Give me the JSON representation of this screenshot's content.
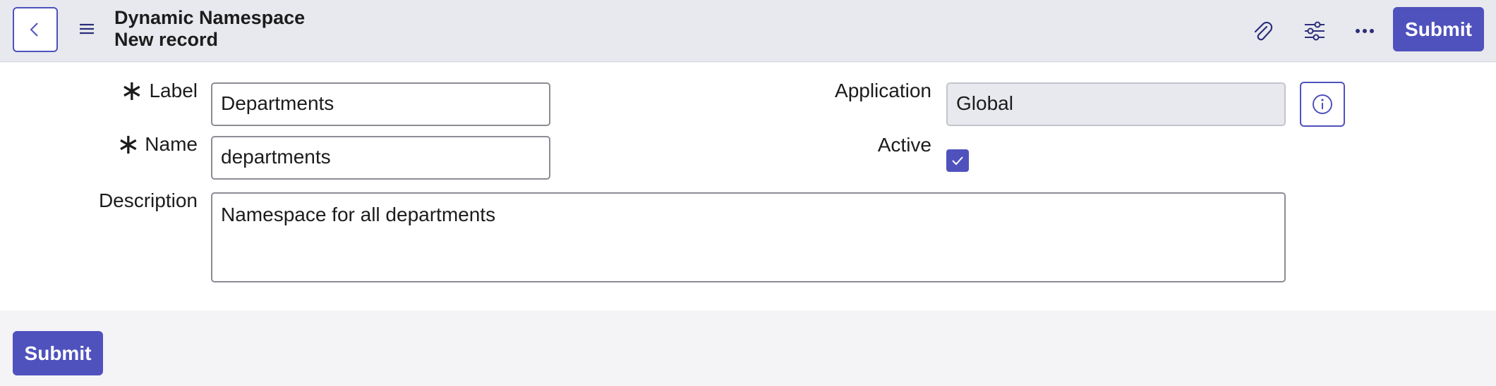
{
  "header": {
    "title": "Dynamic Namespace",
    "subtitle": "New record",
    "submit_label": "Submit",
    "icons": [
      "chevron-left-icon",
      "menu-icon",
      "paperclip-icon",
      "sliders-icon",
      "more-icon"
    ]
  },
  "form": {
    "label": {
      "label": "Label",
      "value": "Departments",
      "required": true
    },
    "name": {
      "label": "Name",
      "value": "departments",
      "required": true
    },
    "description": {
      "label": "Description",
      "value": "Namespace for all departments"
    },
    "application": {
      "label": "Application",
      "value": "Global"
    },
    "active": {
      "label": "Active",
      "checked": true
    },
    "required_marker": "∗"
  },
  "footer": {
    "submit_label": "Submit"
  },
  "colors": {
    "accent": "#4f52bd",
    "header_bg": "#e8e9ee",
    "readonly_bg": "#e8e9ee"
  }
}
